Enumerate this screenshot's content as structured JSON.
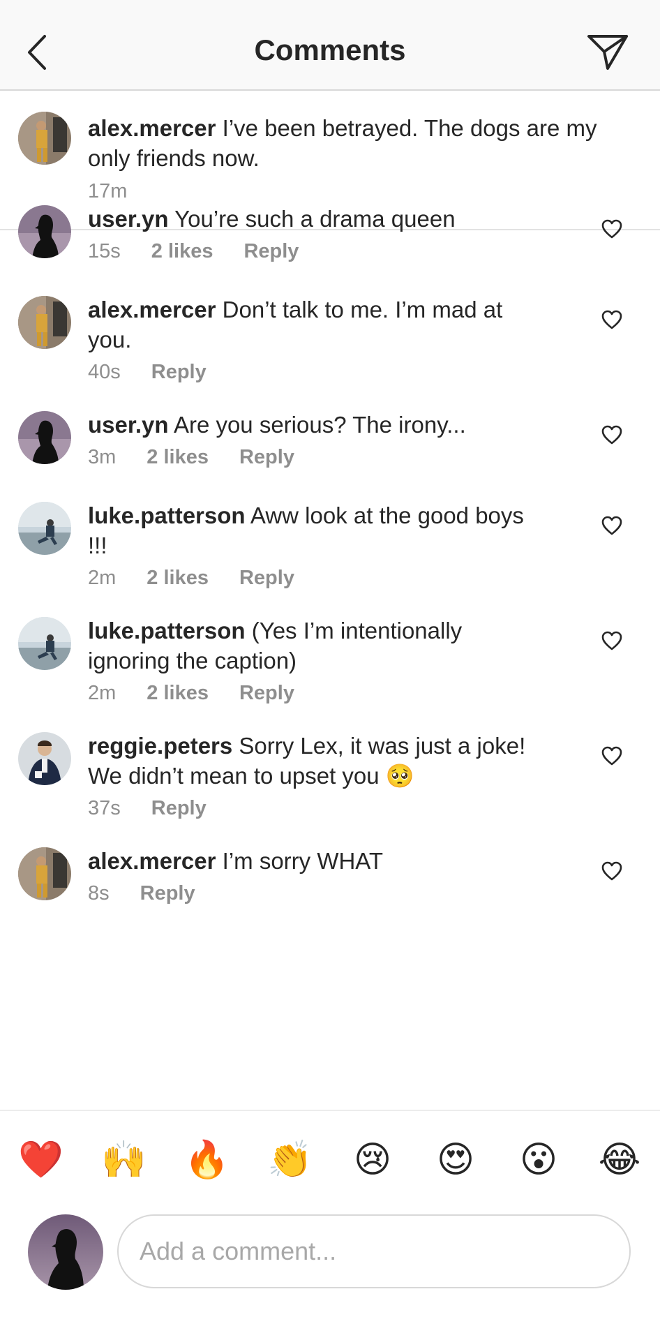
{
  "header": {
    "title": "Comments",
    "back_icon": "chevron-left-icon",
    "send_icon": "paper-plane-icon"
  },
  "caption": {
    "username": "alex.mercer",
    "text": "I’ve been betrayed. The dogs are my only friends now.",
    "time": "17m"
  },
  "comments": [
    {
      "username": "user.yn",
      "text": "You’re such a drama queen",
      "time": "15s",
      "likes": "2 likes",
      "reply": "Reply",
      "avatar": "silhouette"
    },
    {
      "username": "alex.mercer",
      "text": "Don’t talk to me. I’m mad at you.",
      "time": "40s",
      "likes": "",
      "reply": "Reply",
      "avatar": "alex"
    },
    {
      "username": "user.yn",
      "text": "Are you serious? The irony...",
      "time": "3m",
      "likes": "2 likes",
      "reply": "Reply",
      "avatar": "silhouette"
    },
    {
      "username": "luke.patterson",
      "text": "Aww look at the good boys !!!",
      "time": "2m",
      "likes": "2 likes",
      "reply": "Reply",
      "avatar": "luke"
    },
    {
      "username": "luke.patterson",
      "text": "(Yes I’m intentionally ignoring the caption)",
      "time": "2m",
      "likes": "2 likes",
      "reply": "Reply",
      "avatar": "luke"
    },
    {
      "username": "reggie.peters",
      "text": "Sorry Lex, it was just a joke! We didn’t mean to upset you 🥺",
      "time": "37s",
      "likes": "",
      "reply": "Reply",
      "avatar": "reggie"
    },
    {
      "username": "alex.mercer",
      "text": "I’m sorry WHAT",
      "time": "8s",
      "likes": "",
      "reply": "Reply",
      "avatar": "alex"
    }
  ],
  "emoji_bar": [
    "❤️",
    "🙌",
    "🔥",
    "👏",
    "😢",
    "😍",
    "😮",
    "😂"
  ],
  "composer": {
    "placeholder": "Add a comment..."
  },
  "colors": {
    "text": "#262626",
    "meta": "#8e8e8e",
    "header_bg": "#f9f9f9",
    "divider": "#d8d8d8"
  }
}
